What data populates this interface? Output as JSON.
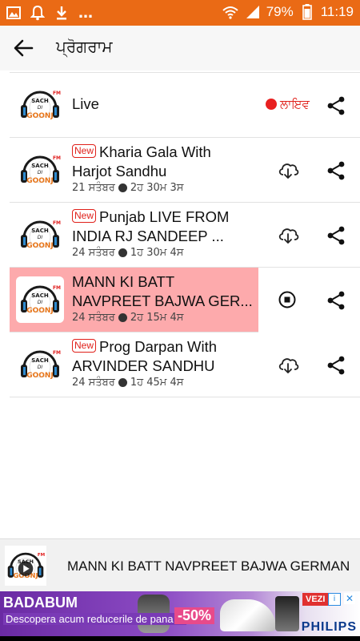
{
  "status_bar": {
    "battery": "79%",
    "time": "11:19",
    "bg_color": "#ea6a15"
  },
  "app_bar": {
    "title": "ਪ੍ਰੋਗਰਾਮ"
  },
  "live_row": {
    "title": "Live",
    "badge": "ਲਾਇਵ"
  },
  "episodes": [
    {
      "new": "New",
      "title_line1": "Kharia Gala With",
      "title_line2": "Harjot Sandhu",
      "date": "21 ਸਤੰਬਰ",
      "duration": "2ਹ 30ਮ 3ਸ"
    },
    {
      "new": "New",
      "title_line1": "Punjab LIVE FROM",
      "title_line2": "INDIA RJ SANDEEP ...",
      "date": "24 ਸਤੰਬਰ",
      "duration": "1ਹ 30ਮ 4ਸ"
    },
    {
      "title_line1": "MANN KI BATT",
      "title_line2": "NAVPREET BAJWA GER...",
      "date": "24 ਸਤੰਬਰ",
      "duration": "2ਹ 15ਮ 4ਸ"
    },
    {
      "new": "New",
      "title_line1": "Prog Darpan With",
      "title_line2": "ARVINDER SANDHU",
      "date": "24 ਸਤੰਬਰ",
      "duration": "1ਹ 45ਮ 4ਸ"
    }
  ],
  "player": {
    "now_playing": "MANN KI BATT NAVPREET BAJWA GERMAN"
  },
  "ad": {
    "brand": "BADABUM",
    "text": "Descopera acum reducerile de pana la",
    "discount": "-50%",
    "button": "VEZI O",
    "sponsor": "PHILIPS"
  },
  "logo": {
    "line1": "SACH",
    "line2": "DI",
    "line3": "GOONJ",
    "tag": "FM"
  }
}
